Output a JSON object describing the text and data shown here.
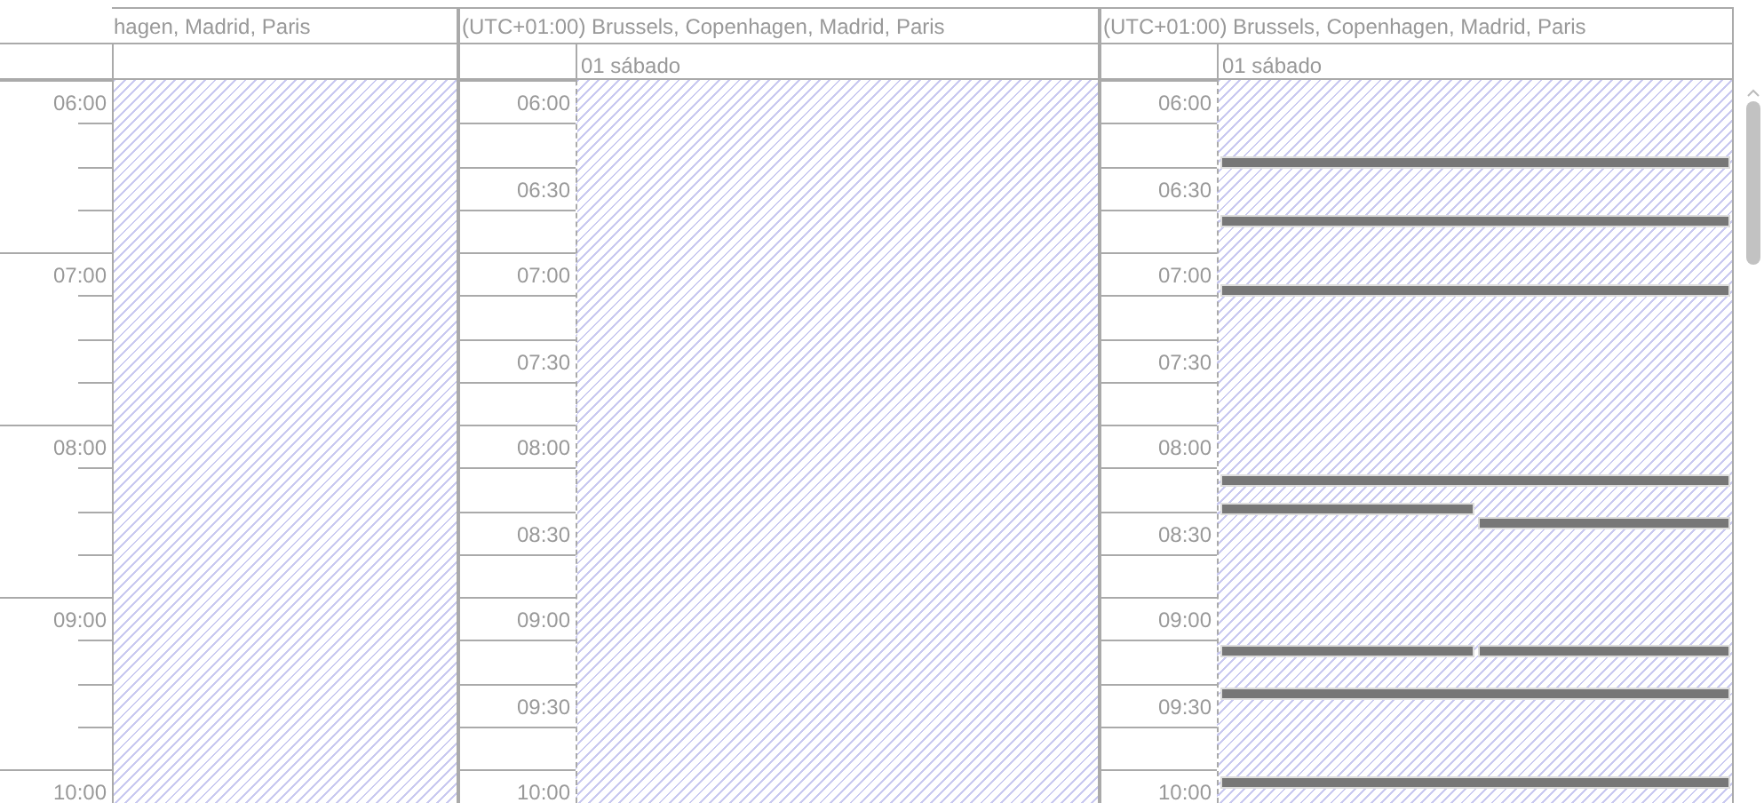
{
  "panels": [
    {
      "timezone": "hagen, Madrid, Paris",
      "time_labels": [
        "06:00",
        "07:00",
        "08:00",
        "09:00",
        "10:00"
      ]
    },
    {
      "timezone": "(UTC+01:00) Brussels, Copenhagen, Madrid, Paris",
      "day": "01 sábado",
      "time_labels": [
        "06:00",
        "06:30",
        "07:00",
        "07:30",
        "08:00",
        "08:30",
        "09:00",
        "09:30",
        "10:00"
      ]
    },
    {
      "timezone": "(UTC+01:00) Brussels, Copenhagen, Madrid, Paris",
      "day": "01 sábado",
      "time_labels": [
        "06:00",
        "06:30",
        "07:00",
        "07:30",
        "08:00",
        "08:30",
        "09:00",
        "09:30",
        "10:00"
      ],
      "events": [
        {
          "kind": "full"
        },
        {
          "kind": "full"
        },
        {
          "kind": "full"
        },
        {
          "kind": "full"
        },
        {
          "kind": "left"
        },
        {
          "kind": "right"
        },
        {
          "kind": "left"
        },
        {
          "kind": "right"
        },
        {
          "kind": "full"
        },
        {
          "kind": "full"
        }
      ]
    }
  ]
}
